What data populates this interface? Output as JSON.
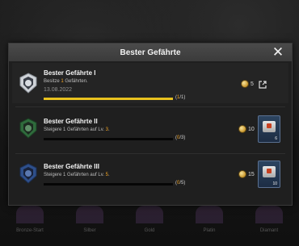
{
  "header": {
    "title": "Bester Gefährte"
  },
  "achievements": [
    {
      "title": "Bester Gefährte I",
      "desc_pre": "Besitze ",
      "desc_hl": "1",
      "desc_post": " Gefährten.",
      "date": "13.08.2022",
      "progress_done": "1",
      "progress_total": "/1)",
      "progress_fraction": 1.0,
      "reward": "5",
      "state": "completed"
    },
    {
      "title": "Bester Gefährte II",
      "desc_pre": "Steigere 1 Gefährten auf Lv. ",
      "desc_hl": "3",
      "desc_post": ".",
      "progress_done": "0",
      "progress_total": "/3)",
      "progress_fraction": 0.0,
      "reward": "10",
      "crate_count": "6",
      "state": "locked"
    },
    {
      "title": "Bester Gefährte III",
      "desc_pre": "Steigere 1 Gefährten auf Lv. ",
      "desc_hl": "5",
      "desc_post": ".",
      "progress_done": "0",
      "progress_total": "/5)",
      "progress_fraction": 0.0,
      "reward": "15",
      "crate_count": "10",
      "state": "locked"
    }
  ],
  "background_items": [
    "Bronze-Start",
    "Silber",
    "Gold",
    "Platin",
    "Diamant"
  ],
  "colors": {
    "highlight": "#f5a623",
    "progress": "#e8c11e",
    "badge_green": "#2f6b3c",
    "badge_blue": "#2e4f8a"
  }
}
